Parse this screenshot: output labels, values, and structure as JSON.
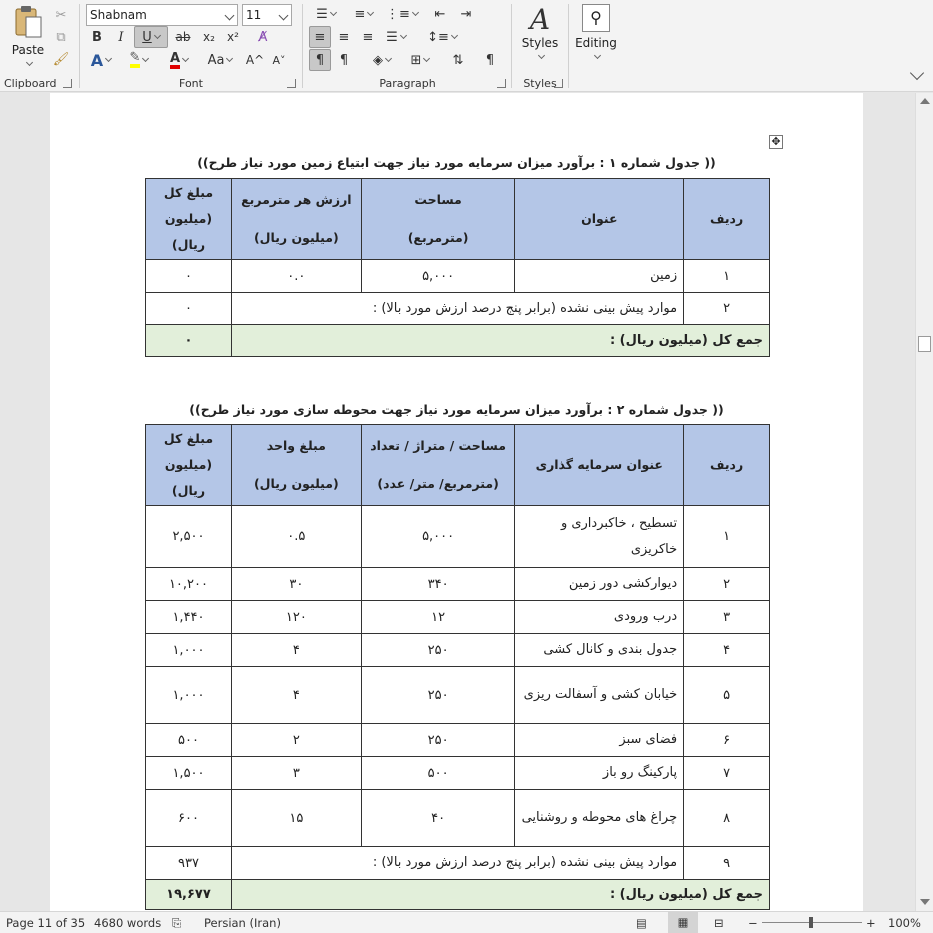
{
  "ribbon": {
    "clipboard": {
      "label": "Clipboard",
      "paste_label": "Paste"
    },
    "font": {
      "label": "Font",
      "font_name": "Shabnam",
      "font_size": "11",
      "bold": "B",
      "italic": "I",
      "underline": "U",
      "strike": "ab",
      "subscript": "x₂",
      "superscript": "x²",
      "grow": "A^",
      "shrink": "A˅",
      "change_case": "Aa"
    },
    "paragraph": {
      "label": "Paragraph"
    },
    "styles": {
      "label": "Styles",
      "button_label": "Styles"
    },
    "editing": {
      "button_label": "Editing"
    }
  },
  "table1": {
    "caption": "(( جدول شماره ۱ : برآورد میزان سرمایه مورد نیاز جهت ابتیاع زمین مورد نیاز طرح))",
    "headers": {
      "row": "ردیف",
      "title": "عنوان",
      "area": "مساحت",
      "area_unit": "(مترمربع)",
      "unit_value": "ارزش هر مترمربع",
      "unit_value_unit": "(میلیون ریال)",
      "total": "مبلغ کل",
      "total_unit": "(میلیون",
      "total_unit2": "ریال)"
    },
    "rows": [
      {
        "row": "۱",
        "title": "زمین",
        "area": "۵,۰۰۰",
        "unit_value": "۰.۰",
        "total": "۰"
      }
    ],
    "unforeseen": {
      "row": "۲",
      "title": "موارد پیش بینی نشده (برابر پنج درصد ارزش مورد بالا) :",
      "total": "۰"
    },
    "sum": {
      "label": "جمع کل (میلیون ریال) :",
      "value": "۰"
    }
  },
  "table2": {
    "caption": "(( جدول شماره ۲ : برآورد میزان سرمایه مورد نیاز جهت محوطه سازی مورد نیاز طرح))",
    "headers": {
      "row": "ردیف",
      "title": "عنوان سرمایه گذاری",
      "qty": "مساحت / متراژ / تعداد",
      "qty_unit": "(مترمربع/ متر/ عدد)",
      "unit_price": "مبلغ  واحد",
      "unit_price_unit": "(میلیون ریال)",
      "total": "مبلغ کل",
      "total_unit": "(میلیون",
      "total_unit2": "ریال)"
    },
    "rows": [
      {
        "row": "۱",
        "title": "تسطیح ، خاکبرداری و خاکریزی",
        "qty": "۵,۰۰۰",
        "unit_price": "۰.۵",
        "total": "۲,۵۰۰"
      },
      {
        "row": "۲",
        "title": "دیوارکشی دور زمین",
        "qty": "۳۴۰",
        "unit_price": "۳۰",
        "total": "۱۰,۲۰۰"
      },
      {
        "row": "۳",
        "title": "درب ورودی",
        "qty": "۱۲",
        "unit_price": "۱۲۰",
        "total": "۱,۴۴۰"
      },
      {
        "row": "۴",
        "title": "جدول بندی و کانال کشی",
        "qty": "۲۵۰",
        "unit_price": "۴",
        "total": "۱,۰۰۰"
      },
      {
        "row": "۵",
        "title": "خیابان کشی و آسفالت ریزی",
        "qty": "۲۵۰",
        "unit_price": "۴",
        "total": "۱,۰۰۰"
      },
      {
        "row": "۶",
        "title": "فضای سبز",
        "qty": "۲۵۰",
        "unit_price": "۲",
        "total": "۵۰۰"
      },
      {
        "row": "۷",
        "title": "پارکینگ رو باز",
        "qty": "۵۰۰",
        "unit_price": "۳",
        "total": "۱,۵۰۰"
      },
      {
        "row": "۸",
        "title": "چراغ های محوطه و روشنایی",
        "qty": "۴۰",
        "unit_price": "۱۵",
        "total": "۶۰۰"
      }
    ],
    "unforeseen": {
      "row": "۹",
      "title": "موارد پیش بینی نشده (برابر پنج درصد ارزش مورد بالا) :",
      "total": "۹۳۷"
    },
    "sum": {
      "label": "جمع کل (میلیون ریال) :",
      "value": "۱۹,۶۷۷"
    }
  },
  "status": {
    "page": "Page 11 of 35",
    "words": "4680 words",
    "language": "Persian (Iran)",
    "zoom_minus": "−",
    "zoom_plus": "+",
    "zoom": "100%"
  },
  "colors": {
    "header_fill": "#b4c6e7",
    "sum_fill": "#e2efda",
    "accent": "#2b579a"
  }
}
